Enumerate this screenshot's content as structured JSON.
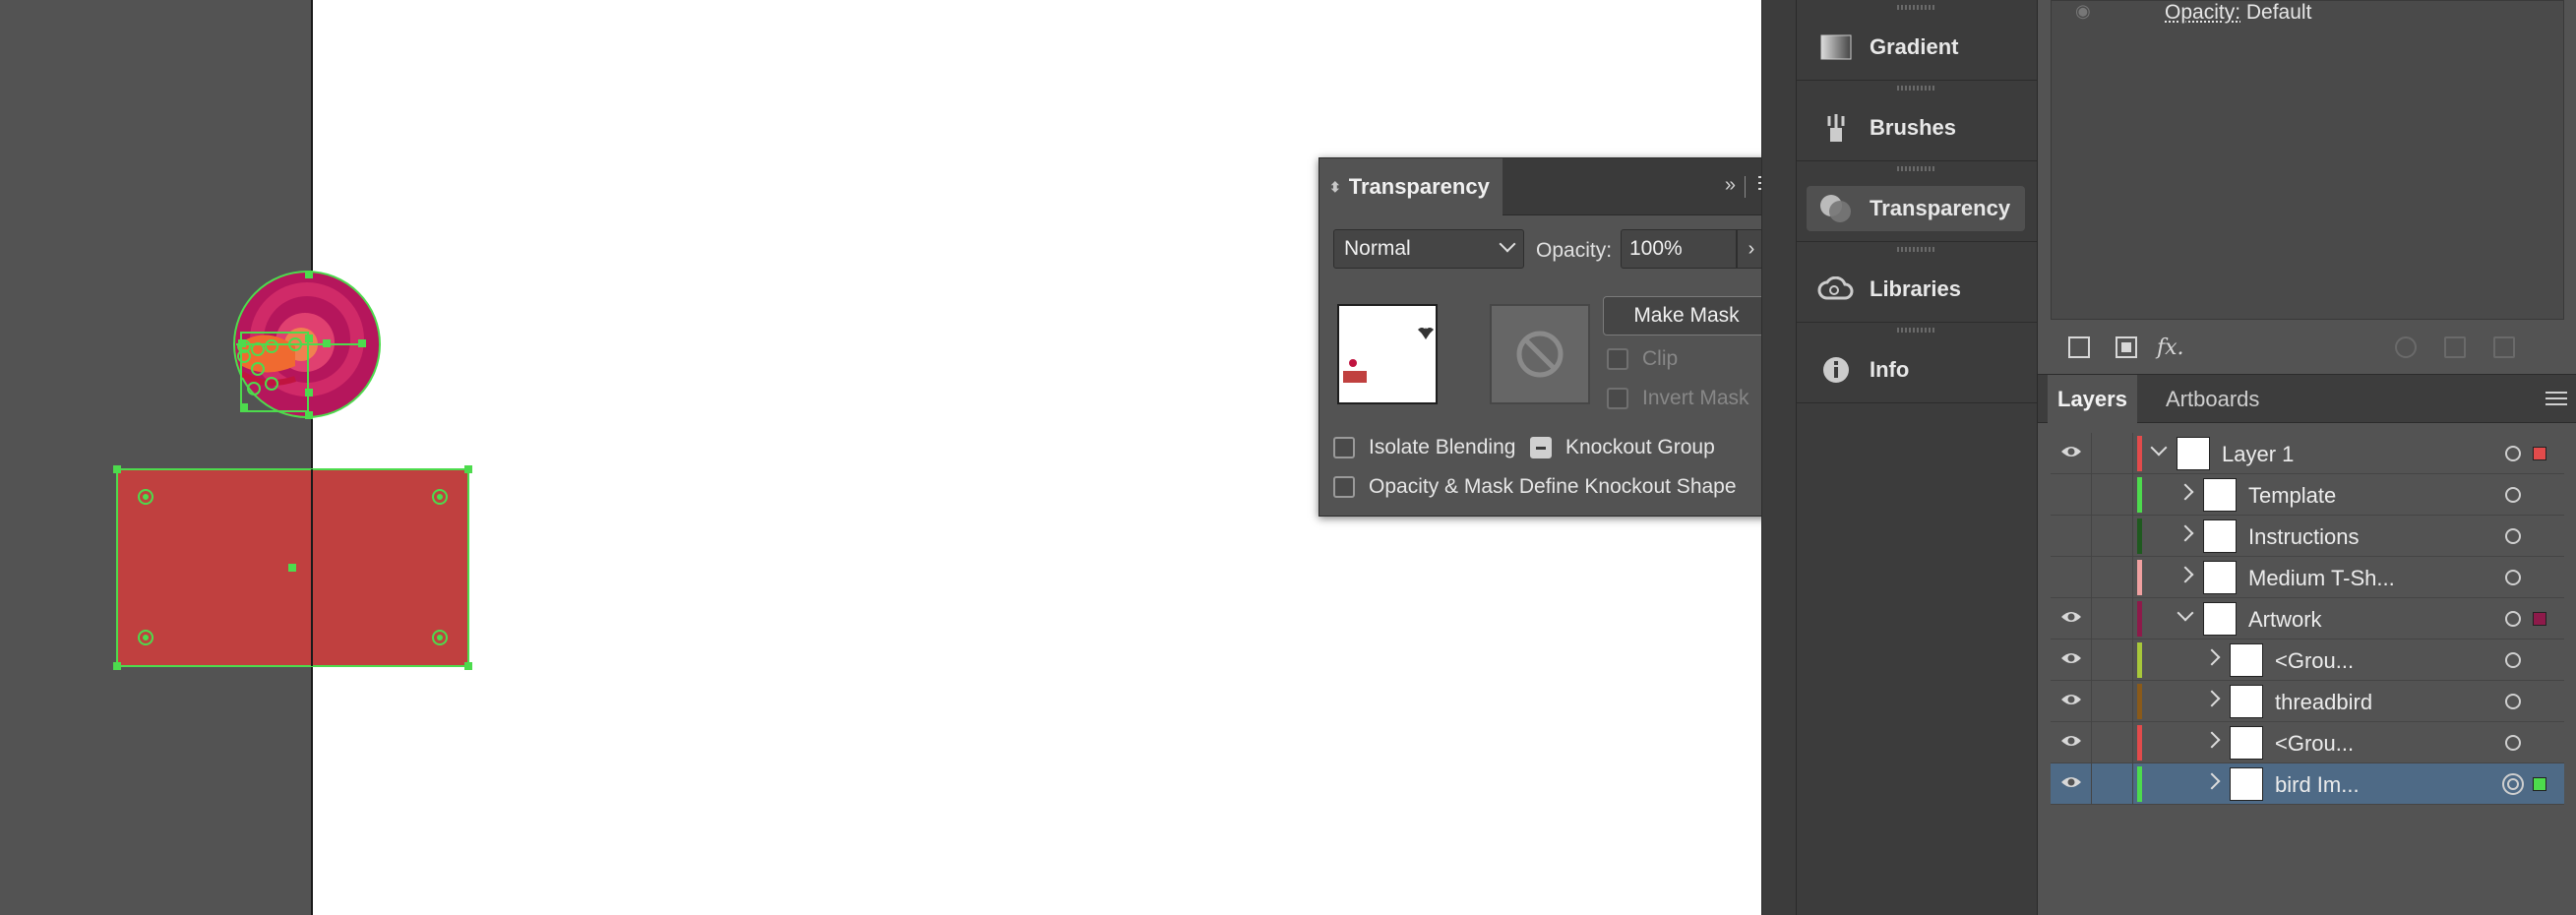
{
  "transparency_panel": {
    "title": "Transparency",
    "blend_mode": "Normal",
    "opacity_label": "Opacity:",
    "opacity_value": "100%",
    "make_mask_label": "Make Mask",
    "clip_label": "Clip",
    "invert_mask_label": "Invert Mask",
    "isolate_blending_label": "Isolate Blending",
    "knockout_group_label": "Knockout Group",
    "opacity_mask_knockout_label": "Opacity & Mask Define Knockout Shape"
  },
  "dock": {
    "items": [
      {
        "label": "Gradient",
        "icon": "gradient-icon"
      },
      {
        "label": "Brushes",
        "icon": "brushes-icon"
      },
      {
        "label": "Transparency",
        "icon": "transparency-icon",
        "active": true
      },
      {
        "label": "Libraries",
        "icon": "cc-libraries-icon"
      },
      {
        "label": "Info",
        "icon": "info-icon"
      }
    ]
  },
  "appearance_strip": {
    "opacity_key": "Opacity:",
    "opacity_value": "Default"
  },
  "layers_panel": {
    "tabs": [
      {
        "label": "Layers",
        "active": true
      },
      {
        "label": "Artboards",
        "active": false
      }
    ],
    "rows": [
      {
        "name": "Layer 1",
        "visible": true,
        "color": "#e24b4b",
        "level": 0,
        "expanded": true,
        "selected": false
      },
      {
        "name": "Template",
        "visible": false,
        "color": "#4ddb4d",
        "level": 1,
        "expanded": false,
        "selected": false
      },
      {
        "name": "Instructions",
        "visible": false,
        "color": "#1f5a1f",
        "level": 1,
        "expanded": false,
        "selected": false
      },
      {
        "name": "Medium T-Sh...",
        "visible": false,
        "color": "#f0a0a0",
        "level": 1,
        "expanded": false,
        "selected": false
      },
      {
        "name": "Artwork",
        "visible": true,
        "color": "#8e1a4a",
        "level": 1,
        "expanded": true,
        "selected": false
      },
      {
        "name": "<Grou...",
        "visible": true,
        "color": "#a8c83a",
        "level": 2,
        "expanded": false,
        "selected": false
      },
      {
        "name": "threadbird",
        "visible": true,
        "color": "#8a5a1a",
        "level": 2,
        "expanded": false,
        "selected": false
      },
      {
        "name": "<Grou...",
        "visible": true,
        "color": "#e24b4b",
        "level": 2,
        "expanded": false,
        "selected": false
      },
      {
        "name": "bird Im...",
        "visible": true,
        "color": "#4ddb4d",
        "level": 2,
        "expanded": false,
        "selected": true
      }
    ]
  },
  "colors": {
    "artwork_red": "#c0403f",
    "selection_green": "#4ddb4d",
    "spiral_outer": "#b5165c",
    "spiral_mid": "#e04070",
    "spiral_inner": "#f08050"
  }
}
